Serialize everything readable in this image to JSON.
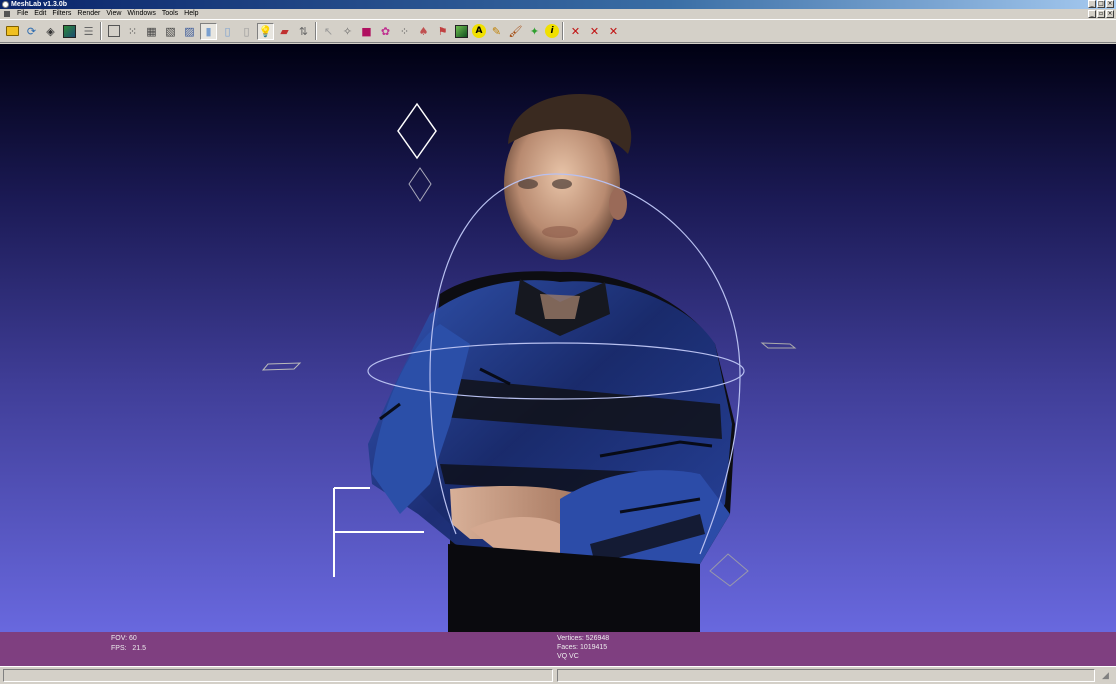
{
  "window": {
    "title": "MeshLab v1.3.0b",
    "controls": [
      "_",
      "□",
      "×"
    ]
  },
  "menu": {
    "items": [
      "File",
      "Edit",
      "Filters",
      "Render",
      "View",
      "Windows",
      "Tools",
      "Help"
    ],
    "mdi_controls": [
      "_",
      "▫",
      "×"
    ]
  },
  "toolbar": {
    "groups": [
      [
        "open-project-icon",
        "reload-icon",
        "save-snapshot-icon",
        "import-mesh-icon",
        "layers-icon"
      ],
      [
        "bounding-box-icon",
        "points-icon",
        "wireframe-icon",
        "hidden-lines-icon",
        "flat-lines-icon",
        "flat-icon",
        "smooth-icon",
        "light-icon",
        "texture-icon",
        "flip-icon"
      ],
      [
        "select-icon",
        "pick-point-icon",
        "measure-icon",
        "paint-icon",
        "align-icon",
        "manipulator-icon",
        "raster-icon",
        "annotate-icon",
        "draw-icon",
        "select-faces-icon",
        "info-icon"
      ],
      [
        "delete-faces-icon",
        "delete-vertices-icon",
        "delete-selection-icon"
      ]
    ],
    "pressed": [
      "smooth-icon",
      "light-icon"
    ]
  },
  "viewport": {
    "background_top": "#000012",
    "background_bottom": "#6e6ee8",
    "info": {
      "fov_label": "FOV: 60",
      "fps_label": "FPS:   21.5",
      "vertices_label": "Vertices: 526948",
      "faces_label": "Faces: 1019415",
      "mode_label": "VQ VC"
    }
  },
  "statusbar": {}
}
